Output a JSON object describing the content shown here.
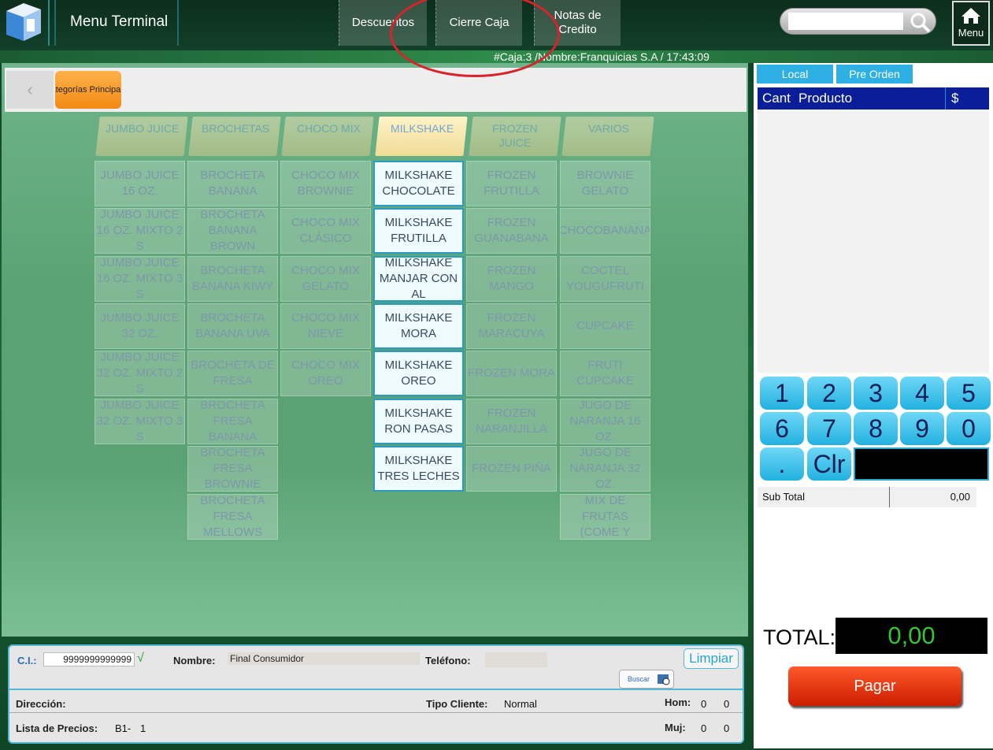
{
  "header": {
    "app_title": "Menu Terminal",
    "buttons": [
      "Descuentos",
      "Cierre Caja",
      "Notas de\nCredito"
    ],
    "search_placeholder": "",
    "home_label": "Menu"
  },
  "status_line": "#Caja:3  /Nombre:Franquicias S.A  / 17:43:09",
  "breadcrumb": {
    "back_glyph": "‹",
    "category": "Categorías Principales"
  },
  "tabs": [
    "JUMBO JUICE",
    "BROCHETAS",
    "CHOCO MIX",
    "MILKSHAKE",
    "FROZEN\nJUICE",
    "VARIOS"
  ],
  "active_tab": "MILKSHAKE",
  "products": [
    [
      "JUMBO JUICE\n16 OZ.",
      "JUMBO JUICE\n16 OZ. MIXTO 2 S",
      "JUMBO JUICE\n16 OZ. MIXTO 3 S",
      "JUMBO JUICE\n32 OZ.",
      "JUMBO JUICE\n32 OZ. MIXTO 2 S",
      "JUMBO JUICE\n32 OZ. MIXTO 3 S"
    ],
    [
      "BROCHETA\nBANANA",
      "BROCHETA\nBANANA BROWN",
      "BROCHETA\nBANANA KIWY",
      "BROCHETA\nBANANA UVA",
      "BROCHETA DE\nFRESA",
      "BROCHETA\nFRESA BANANA",
      "BROCHETA\nFRESA BROWNIE",
      "BROCHETA\nFRESA MELLOWS"
    ],
    [
      "CHOCO MIX\nBROWNIE",
      "CHOCO MIX\nCLÁSICO",
      "CHOCO MIX\nGELATO",
      "CHOCO MIX\nNIEVE",
      "CHOCO MIX\nOREO"
    ],
    [
      "MILKSHAKE\nCHOCOLATE",
      "MILKSHAKE\nFRUTILLA",
      "MILKSHAKE\nMANJAR CON AL",
      "MILKSHAKE\nMORA",
      "MILKSHAKE\nOREO",
      "MILKSHAKE\nRON PASAS",
      "MILKSHAKE\nTRES LECHES"
    ],
    [
      "FROZEN\nFRUTILLA",
      "FROZEN\nGUANABANA",
      "FROZEN MANGO",
      "FROZEN\nMARACUYA",
      "FROZEN MORA",
      "FROZEN\nNARANJILLA",
      "FROZEN PIÑA"
    ],
    [
      "BROWNIE\nGELATO",
      "CHOCOBANANA",
      "COCTEL\nYOUGUFRUTI",
      "CUPCAKE",
      "FRUTI CUPCAKE",
      "JUGO DE\nNARANJA 16 OZ.",
      "JUGO DE\nNARANJA 32 OZ.",
      "MIX DE\nFRUTAS (COME Y"
    ]
  ],
  "customer": {
    "ci_label": "C.I.:",
    "ci_value": "9999999999999",
    "check": "√",
    "name_label": "Nombre:",
    "name_value": "Final Consumidor",
    "phone_label": "Teléfono:",
    "phone_value": "",
    "clear_label": "Limpiar",
    "search_label": "Buscar",
    "address_label": "Dirección:",
    "client_type_label": "Tipo Cliente:",
    "client_type_value": "Normal",
    "men_label": "Hom:",
    "men_a": "0",
    "men_b": "0",
    "price_list_label": "Lista de Precios:",
    "price_list_code": "B1-",
    "price_list_value": "1",
    "women_label": "Muj:",
    "women_a": "0",
    "women_b": "0"
  },
  "order": {
    "local_label": "Local",
    "preorder_label": "Pre Orden",
    "col_qty": "Cant",
    "col_product": "Producto",
    "col_price": "$"
  },
  "keypad": [
    "1",
    "2",
    "3",
    "4",
    "5",
    "6",
    "7",
    "8",
    "9",
    "0",
    ".",
    "Clr"
  ],
  "subtotal": {
    "label": "Sub Total",
    "value": "0,00"
  },
  "total": {
    "label": "TOTAL:",
    "value": "0,00"
  },
  "pay_label": "Pagar",
  "colors": {
    "accent": "#2eb0e4",
    "header_blue": "#0a1e9a",
    "pay_red": "#d9260a",
    "total_green": "#35c435",
    "annotation": "#d9232a"
  }
}
